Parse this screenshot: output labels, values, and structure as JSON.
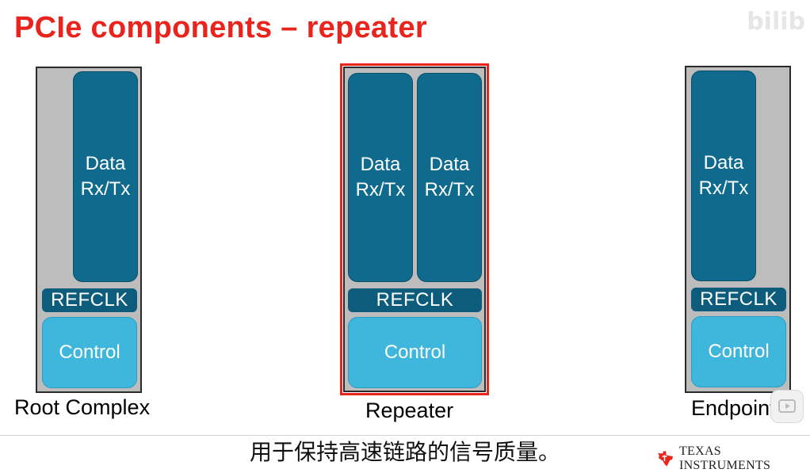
{
  "title": "PCIe components – repeater",
  "watermark": "bilib",
  "components": {
    "root_complex": {
      "label": "Root Complex",
      "data_line1": "Data",
      "data_line2": "Rx/Tx",
      "refclk": "REFCLK",
      "control": "Control"
    },
    "repeater": {
      "label": "Repeater",
      "data_a_line1": "Data",
      "data_a_line2": "Rx/Tx",
      "data_b_line1": "Data",
      "data_b_line2": "Rx/Tx",
      "refclk": "REFCLK",
      "control": "Control"
    },
    "endpoint": {
      "label": "Endpoint",
      "data_line1": "Data",
      "data_line2": "Rx/Tx",
      "refclk": "REFCLK",
      "control": "Control"
    }
  },
  "subtitle": "用于保持高速链路的信号质量。",
  "logo": {
    "text": "TEXAS INSTRUMENTS",
    "icon": "texas-state-logo-icon",
    "color": "#e8241c"
  },
  "colors": {
    "title": "#e8241c",
    "data_block": "#0f6a8d",
    "refclk_block": "#0d5c7b",
    "control_block": "#3fb6dc",
    "component_bg": "#bdbdbd",
    "highlight": "#e8241c"
  }
}
